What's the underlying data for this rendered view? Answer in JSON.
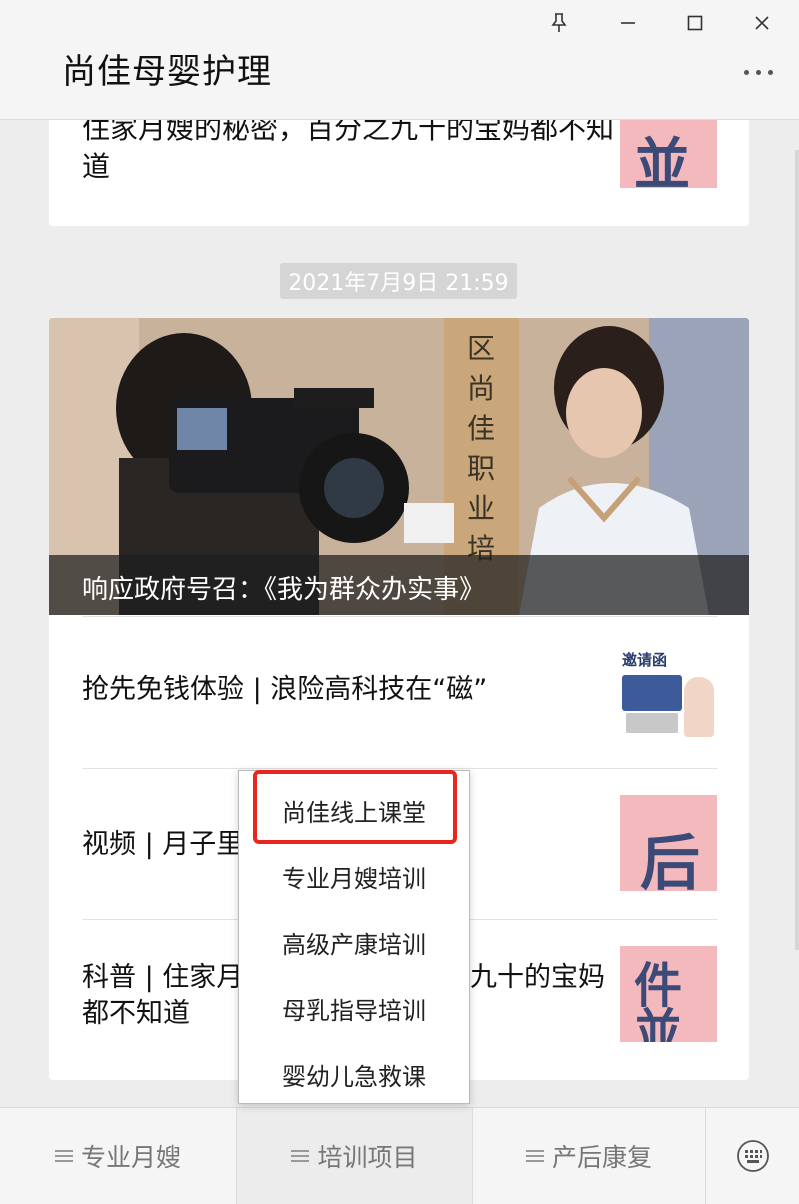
{
  "app": {
    "title": "尚佳母婴护理"
  },
  "window_controls": {
    "pin_icon": "pin-icon",
    "minimize_icon": "minimize-icon",
    "maximize_icon": "maximize-icon",
    "close_icon": "close-icon"
  },
  "feed": {
    "previous_article": {
      "title": "住家月嫂的秘密，百分之九十的宝妈都不知道"
    },
    "timestamp": "2021年7月9日 21:59",
    "featured": {
      "caption": "响应政府号召：《我为群众办实事》"
    },
    "articles": [
      {
        "title": "抢先免钱体验 | 浪险高科技在“磁”",
        "thumb_heading": "邀请函"
      },
      {
        "title": "视频 | 月子里"
      },
      {
        "title": "科普 | 住家月嫂的秘密，百分之九十的宝妈都不知道",
        "line1_left": "科普 | 住家月",
        "line1_right": "九十的宝妈",
        "line2": "都不知道"
      }
    ]
  },
  "popup_menu": {
    "items": [
      "尚佳线上课堂",
      "专业月嫂培训",
      "高级产康培训",
      "母乳指导培训",
      "婴幼儿急救课"
    ],
    "highlighted_index": 0
  },
  "bottom_menu": {
    "tabs": [
      {
        "label": "专业月嫂",
        "active": false
      },
      {
        "label": "培训项目",
        "active": true
      },
      {
        "label": "产后康复",
        "active": false
      }
    ],
    "keyboard_icon": "keyboard-icon"
  },
  "colors": {
    "highlight": "#e8261e",
    "thumb_bg": "#f4b9bd",
    "glyph": "#3c4a78"
  }
}
